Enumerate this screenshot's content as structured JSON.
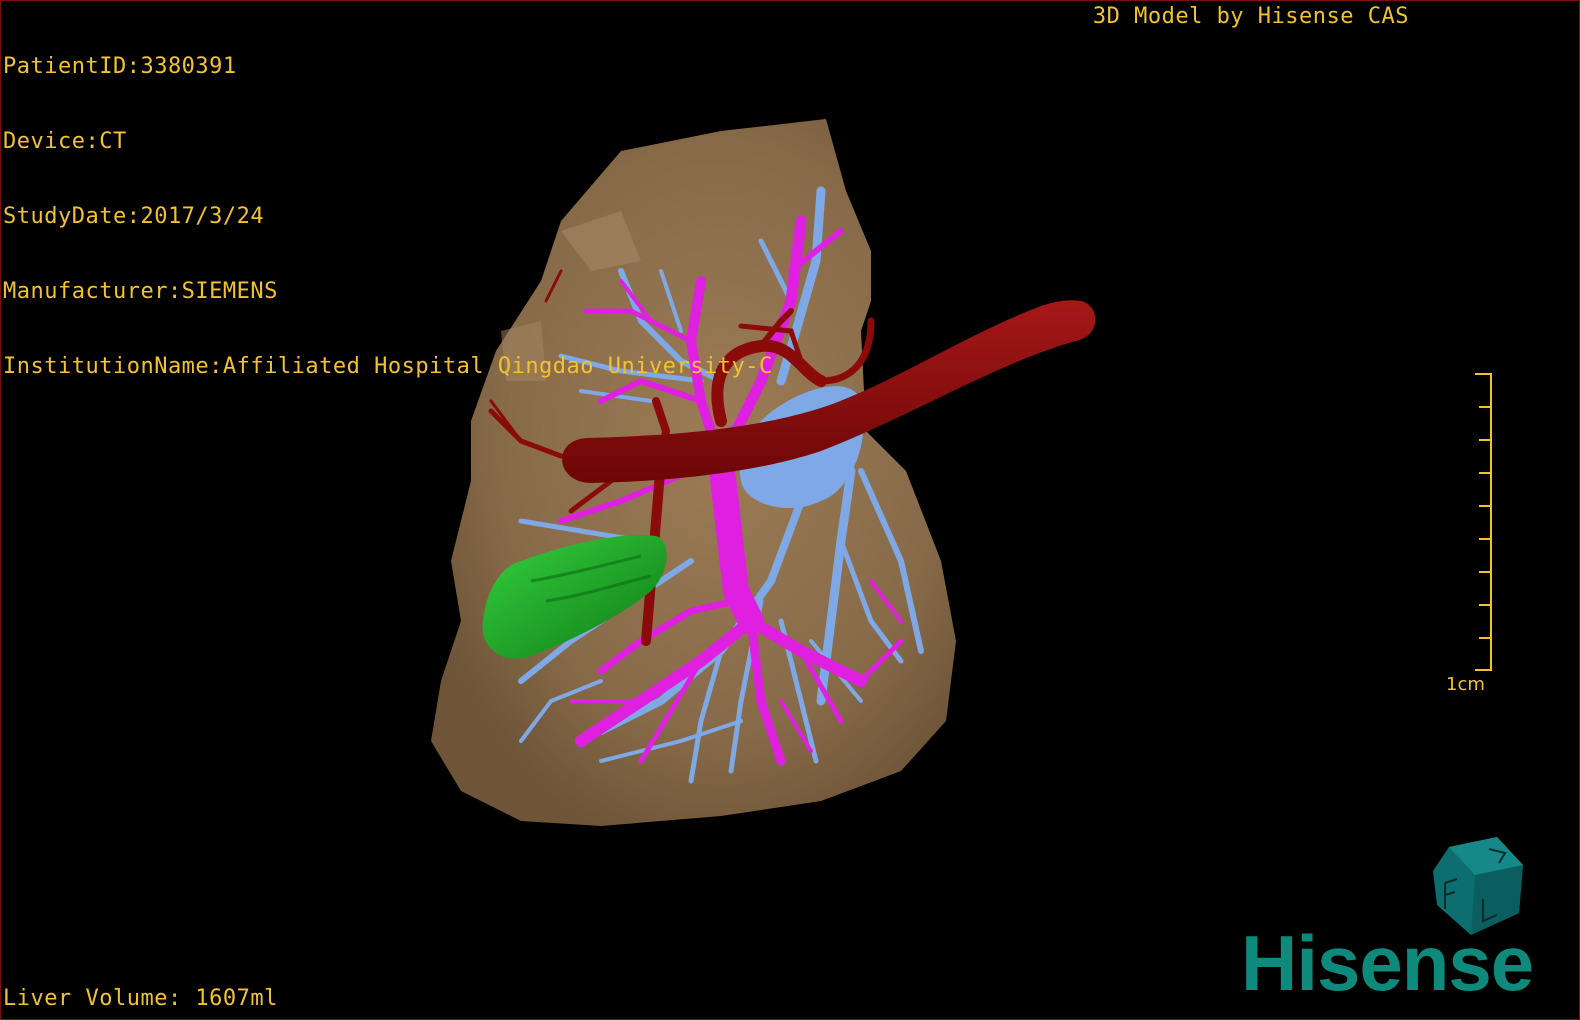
{
  "overlay": {
    "patient_id": "PatientID:3380391",
    "device": "Device:CT",
    "study_date": "StudyDate:2017/3/24",
    "manufacturer": "Manufacturer:SIEMENS",
    "institution": "InstitutionName:Affiliated Hospital Qingdao University-C",
    "credit": "3D Model by Hisense CAS",
    "liver_volume": "Liver Volume: 1607ml"
  },
  "scale": {
    "label": "1cm"
  },
  "brand": {
    "name": "Hisense"
  },
  "colors": {
    "overlay_text": "#f2c230",
    "liver": "#8a6d4a",
    "artery": "#8b0a0a",
    "portal_vein": "#e020e0",
    "hepatic_vein": "#7fa9e6",
    "gallbladder": "#1aa020",
    "brand": "#0e8a7c"
  },
  "orientation_cube": {
    "icon": "orientation-cube-icon"
  }
}
